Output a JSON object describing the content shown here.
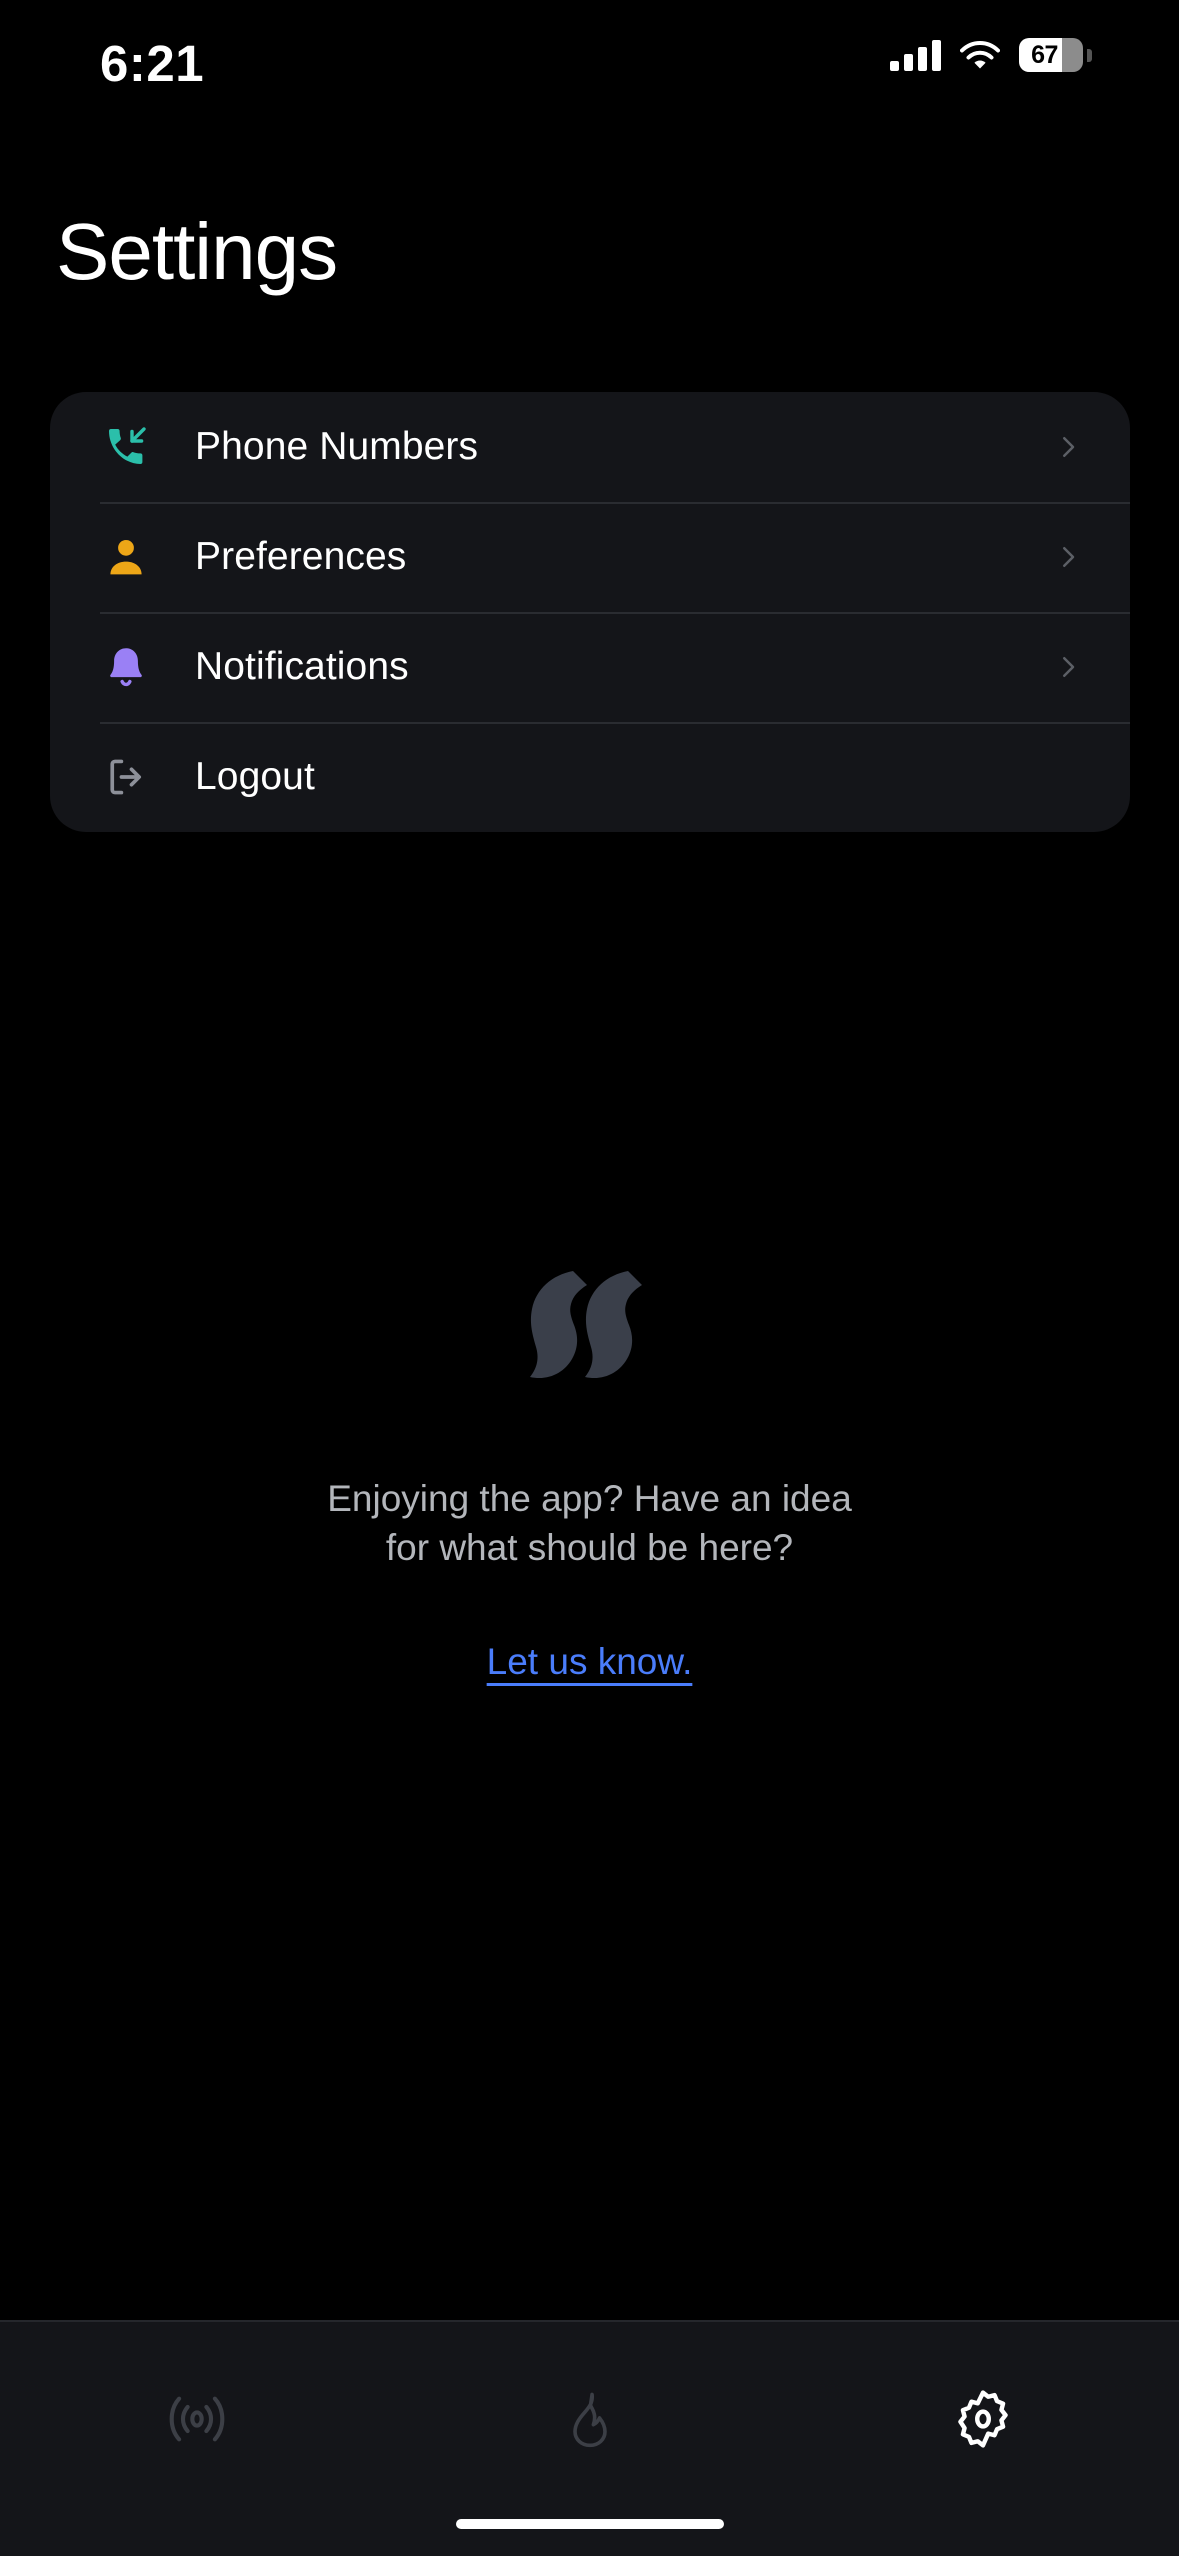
{
  "status_bar": {
    "time": "6:21",
    "battery_percent": "67",
    "battery_level": 67,
    "cellular_icon": "cellular-bars-icon",
    "wifi_icon": "wifi-icon",
    "battery_icon": "battery-icon"
  },
  "header": {
    "title": "Settings"
  },
  "settings_list": {
    "items": [
      {
        "label": "Phone Numbers",
        "icon": "phone-incoming-icon",
        "icon_color": "#2bbfaa",
        "has_chevron": true
      },
      {
        "label": "Preferences",
        "icon": "person-icon",
        "icon_color": "#eda617",
        "has_chevron": true
      },
      {
        "label": "Notifications",
        "icon": "bell-icon",
        "icon_color": "#9a80f5",
        "has_chevron": true
      },
      {
        "label": "Logout",
        "icon": "logout-icon",
        "icon_color": "#8d9099",
        "has_chevron": false
      }
    ]
  },
  "promo": {
    "logo_icon": "app-flame-logo-icon",
    "message_line_1": "Enjoying the app? Have an idea",
    "message_line_2": "for what should be here?",
    "link_label": "Let us know."
  },
  "tab_bar": {
    "tabs": [
      {
        "icon": "broadcast-icon",
        "active": false
      },
      {
        "icon": "flame-icon",
        "active": false
      },
      {
        "icon": "gear-icon",
        "active": true
      }
    ]
  },
  "colors": {
    "background": "#000000",
    "card": "#141519",
    "divider": "#2a2c31",
    "link": "#4a7dfb",
    "muted_text": "#b3b6bb",
    "tab_inactive": "#3c3f46",
    "tab_active": "#ffffff"
  }
}
